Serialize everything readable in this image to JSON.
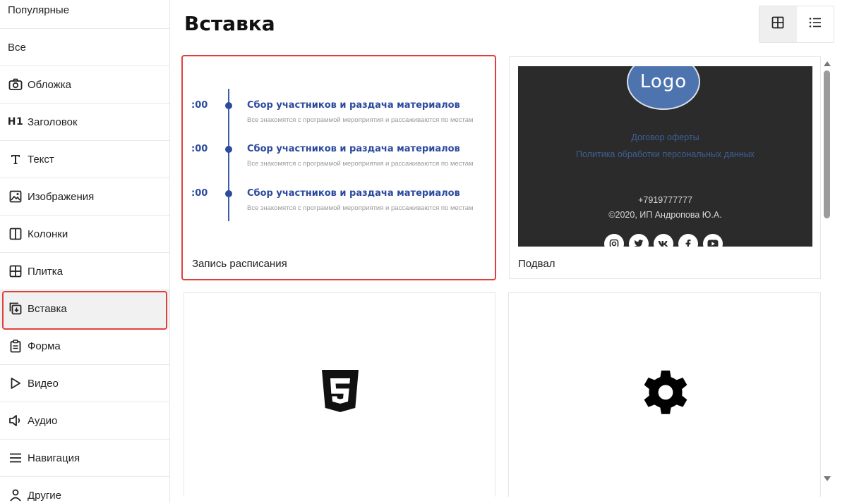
{
  "sidebar": {
    "items": [
      {
        "label": "Популярные",
        "icon": ""
      },
      {
        "label": "Все",
        "icon": ""
      },
      {
        "label": "Обложка",
        "icon": "camera-icon"
      },
      {
        "label": "Заголовок",
        "icon": "h1-icon",
        "icon_text": "H1"
      },
      {
        "label": "Текст",
        "icon": "text-t-icon"
      },
      {
        "label": "Изображения",
        "icon": "image-icon"
      },
      {
        "label": "Колонки",
        "icon": "columns-icon"
      },
      {
        "label": "Плитка",
        "icon": "grid-icon"
      },
      {
        "label": "Вставка",
        "icon": "embed-icon"
      },
      {
        "label": "Форма",
        "icon": "form-clipboard-icon"
      },
      {
        "label": "Видео",
        "icon": "play-icon"
      },
      {
        "label": "Аудио",
        "icon": "speaker-icon"
      },
      {
        "label": "Навигация",
        "icon": "menu-icon"
      },
      {
        "label": "Другие",
        "icon": "person-icon"
      }
    ],
    "active": "Вставка",
    "highlight_color": "#e0403c"
  },
  "header": {
    "title": "Вставка",
    "view_modes": [
      {
        "name": "grid",
        "icon": "grid-view-icon",
        "active": true
      },
      {
        "name": "list",
        "icon": "list-view-icon",
        "active": false
      }
    ]
  },
  "cards": [
    {
      "label": "Запись расписания",
      "selected": true,
      "preview": {
        "type": "schedule",
        "rows": [
          {
            "time": ":00",
            "title": "Сбор участников и раздача материалов",
            "description": "Все знакомятся с программой мероприятия и рассаживаются по местам"
          },
          {
            "time": ":00",
            "title": "Сбор участников и раздача материалов",
            "description": "Все знакомятся с программой мероприятия и рассаживаются по местам"
          },
          {
            "time": ":00",
            "title": "Сбор участников и раздача материалов",
            "description": "Все знакомятся с программой мероприятия и рассаживаются по местам"
          }
        ],
        "accent_color": "#2c4a9e"
      }
    },
    {
      "label": "Подвал",
      "selected": false,
      "preview": {
        "type": "footer",
        "logo_text": "Logo",
        "links": [
          "Договор оферты",
          "Политика обработки персональных данных"
        ],
        "phone": "+7919777777",
        "copyright": "©2020, ИП Андропова Ю.А.",
        "socials": [
          "instagram-icon",
          "twitter-icon",
          "vk-icon",
          "facebook-icon",
          "youtube-icon"
        ],
        "bg_color": "#2b2b2b"
      }
    },
    {
      "label": "",
      "selected": false,
      "preview": {
        "type": "icon",
        "icon": "html5-icon"
      }
    },
    {
      "label": "",
      "selected": false,
      "preview": {
        "type": "icon",
        "icon": "gear-icon"
      }
    }
  ]
}
